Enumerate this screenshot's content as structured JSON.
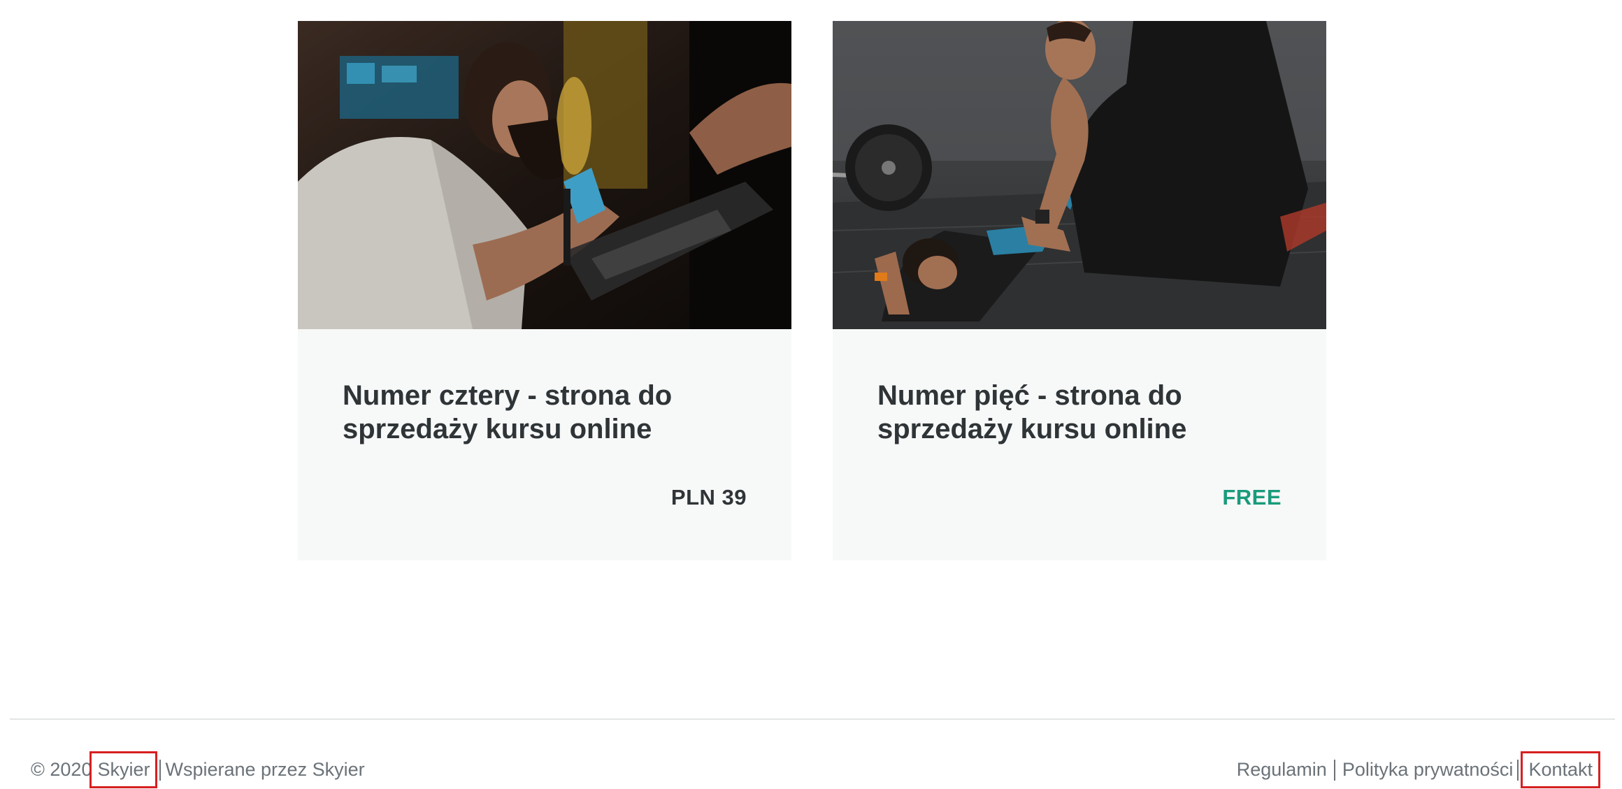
{
  "courses": [
    {
      "title": "Numer cztery - strona do sprzedaży kursu online",
      "price": "PLN 39",
      "image_icon": "tattoo-artist-photo"
    },
    {
      "title": "Numer pięć - strona do sprzedaży kursu online",
      "price": "FREE",
      "image_icon": "fitness-trainer-photo"
    }
  ],
  "footer": {
    "copyright": "© 2020",
    "brand_link": "Skyier",
    "powered_by": "Wspierane przez Skyier",
    "links": {
      "terms": "Regulamin",
      "privacy": "Polityka prywatności",
      "contact": "Kontakt"
    }
  },
  "colors": {
    "free_accent": "#1a9b7b",
    "highlight_box": "#d62020",
    "card_bg": "#f7f8f8"
  }
}
